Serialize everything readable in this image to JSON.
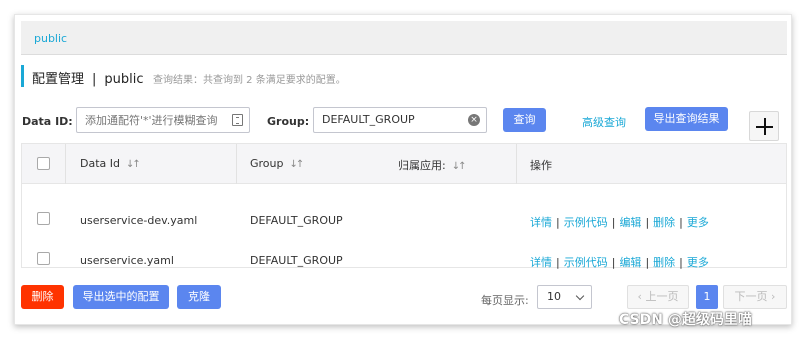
{
  "namespace_tab": "public",
  "title": {
    "main": "配置管理",
    "separator": "|",
    "namespace": "public",
    "hint": "查询结果：共查询到 2 条满足要求的配置。"
  },
  "filters": {
    "data_id_label": "Data ID:",
    "data_id_placeholder": "添加通配符'*'进行模糊查询",
    "group_label": "Group:",
    "group_value": "DEFAULT_GROUP",
    "search_button": "查询",
    "advanced_link": "高级查询",
    "export_button": "导出查询结果"
  },
  "table": {
    "headers": [
      "Data Id",
      "Group",
      "归属应用:",
      "操作"
    ],
    "sort_glyph": "↓↑",
    "rows": [
      {
        "data_id": "userservice-dev.yaml",
        "group": "DEFAULT_GROUP",
        "app": ""
      },
      {
        "data_id": "userservice.yaml",
        "group": "DEFAULT_GROUP",
        "app": ""
      }
    ],
    "actions": [
      "详情",
      "示例代码",
      "编辑",
      "删除",
      "更多"
    ],
    "action_separator": "|"
  },
  "footer": {
    "delete_button": "删除",
    "export_selected_button": "导出选中的配置",
    "clone_button": "克隆",
    "page_size_label": "每页显示:",
    "page_size_value": "10",
    "prev_button": "上一页",
    "current_page": "1",
    "next_button": "下一页"
  },
  "watermark": "CSDN @超级码里喵",
  "colors": {
    "accent": "#1aa8d6",
    "primary": "#5b86ef",
    "danger": "#ff3300"
  }
}
